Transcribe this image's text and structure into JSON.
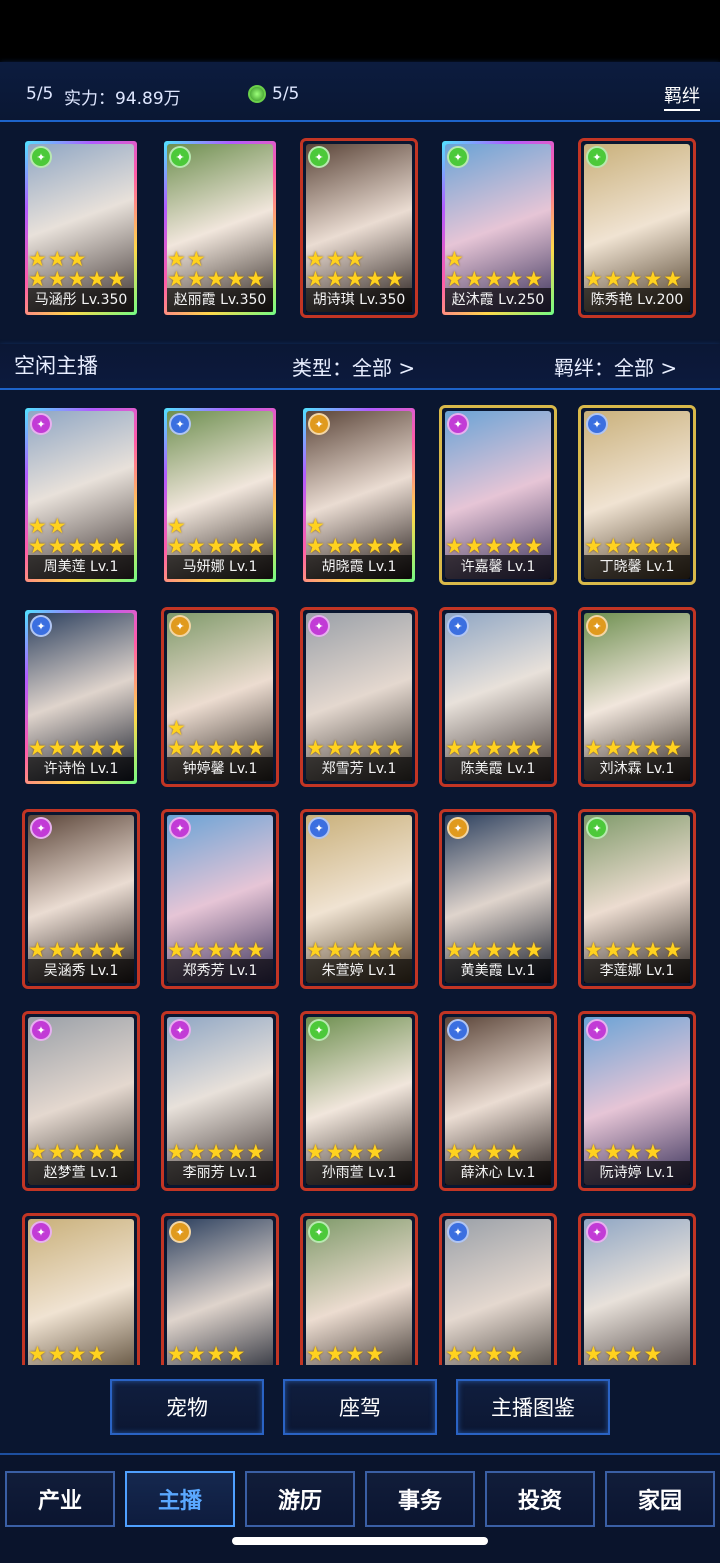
{
  "header": {
    "team_count": "5/5",
    "power_label": "实力：94.89万",
    "gem_count": "5/5",
    "bond_link": "羁绊"
  },
  "filters": {
    "title": "空闲主播",
    "type_filter": "类型：全部 >",
    "bond_filter": "羁绊：全部 >"
  },
  "team": [
    {
      "name": "马涵彤 Lv.350",
      "stars": 8,
      "frame": "rainbow",
      "badge": "green"
    },
    {
      "name": "赵丽霞 Lv.350",
      "stars": 7,
      "frame": "rainbow",
      "badge": "green"
    },
    {
      "name": "胡诗琪 Lv.350",
      "stars": 8,
      "frame": "red",
      "badge": "green"
    },
    {
      "name": "赵沐霞 Lv.250",
      "stars": 6,
      "frame": "rainbow",
      "badge": "green"
    },
    {
      "name": "陈秀艳 Lv.200",
      "stars": 5,
      "frame": "red",
      "badge": "green"
    }
  ],
  "idle": [
    {
      "name": "周美莲 Lv.1",
      "stars": 7,
      "frame": "rainbow",
      "badge": "purple"
    },
    {
      "name": "马妍娜 Lv.1",
      "stars": 6,
      "frame": "rainbow",
      "badge": "blue"
    },
    {
      "name": "胡晓霞 Lv.1",
      "stars": 6,
      "frame": "rainbow",
      "badge": "orange"
    },
    {
      "name": "许嘉馨 Lv.1",
      "stars": 5,
      "frame": "gold",
      "badge": "purple"
    },
    {
      "name": "丁晓馨 Lv.1",
      "stars": 5,
      "frame": "gold",
      "badge": "blue"
    },
    {
      "name": "许诗怡 Lv.1",
      "stars": 5,
      "frame": "rainbow",
      "badge": "blue"
    },
    {
      "name": "钟婷馨 Lv.1",
      "stars": 6,
      "frame": "red",
      "badge": "orange"
    },
    {
      "name": "郑雪芳 Lv.1",
      "stars": 5,
      "frame": "red",
      "badge": "purple"
    },
    {
      "name": "陈美霞 Lv.1",
      "stars": 5,
      "frame": "red",
      "badge": "blue"
    },
    {
      "name": "刘沐霖 Lv.1",
      "stars": 5,
      "frame": "red",
      "badge": "orange"
    },
    {
      "name": "吴涵秀 Lv.1",
      "stars": 5,
      "frame": "red",
      "badge": "purple"
    },
    {
      "name": "郑秀芳 Lv.1",
      "stars": 5,
      "frame": "red",
      "badge": "purple"
    },
    {
      "name": "朱萱婷 Lv.1",
      "stars": 5,
      "frame": "red",
      "badge": "blue"
    },
    {
      "name": "黄美霞 Lv.1",
      "stars": 5,
      "frame": "red",
      "badge": "orange"
    },
    {
      "name": "李莲娜 Lv.1",
      "stars": 5,
      "frame": "red",
      "badge": "green"
    },
    {
      "name": "赵梦萱 Lv.1",
      "stars": 5,
      "frame": "red",
      "badge": "purple"
    },
    {
      "name": "李丽芳 Lv.1",
      "stars": 5,
      "frame": "red",
      "badge": "purple"
    },
    {
      "name": "孙雨萱 Lv.1",
      "stars": 4,
      "frame": "red",
      "badge": "green"
    },
    {
      "name": "薛沐心 Lv.1",
      "stars": 4,
      "frame": "red",
      "badge": "blue"
    },
    {
      "name": "阮诗婷 Lv.1",
      "stars": 4,
      "frame": "red",
      "badge": "purple"
    },
    {
      "name": "",
      "stars": 4,
      "frame": "red",
      "badge": "purple"
    },
    {
      "name": "",
      "stars": 4,
      "frame": "red",
      "badge": "orange"
    },
    {
      "name": "",
      "stars": 4,
      "frame": "red",
      "badge": "green"
    },
    {
      "name": "",
      "stars": 4,
      "frame": "red",
      "badge": "blue"
    },
    {
      "name": "",
      "stars": 4,
      "frame": "red",
      "badge": "purple"
    }
  ],
  "actions": {
    "pet": "宠物",
    "mount": "座驾",
    "gallery": "主播图鉴"
  },
  "nav": {
    "industry": "产业",
    "anchor": "主播",
    "travel": "游历",
    "affairs": "事务",
    "invest": "投资",
    "home": "家园"
  },
  "colors": {
    "accent": "#1d63c9",
    "active_nav": "#5aa8ff",
    "star": "#ffd21f",
    "frame_red": "#c23524",
    "frame_gold": "#d9b94a",
    "badge_green": "#4cc93a",
    "badge_purple": "#c23bd6",
    "badge_blue": "#3b6fe0",
    "badge_orange": "#e09a1e"
  }
}
